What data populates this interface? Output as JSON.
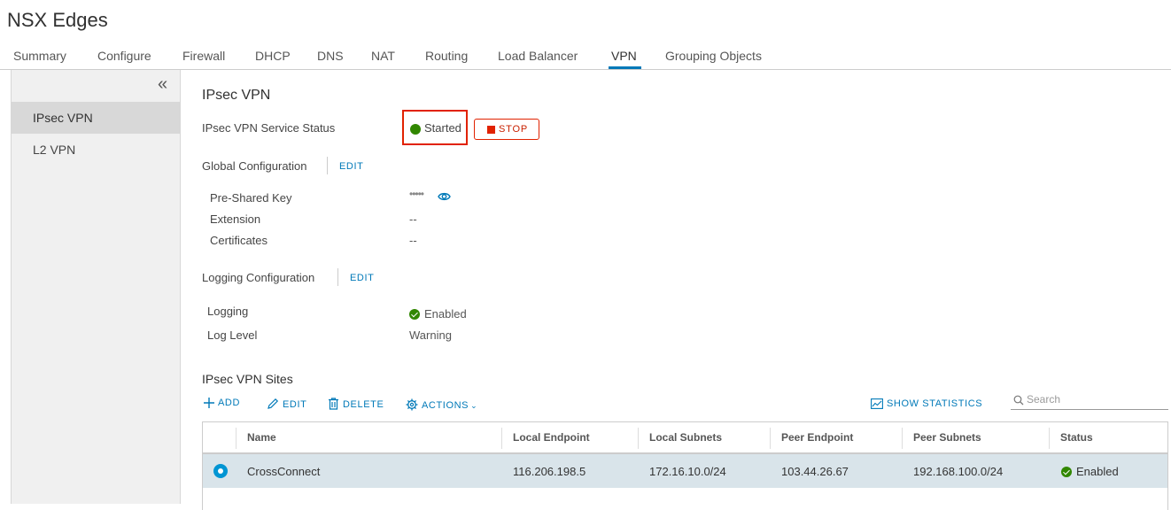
{
  "page": {
    "title": "NSX Edges"
  },
  "tabs": [
    {
      "label": "Summary"
    },
    {
      "label": "Configure"
    },
    {
      "label": "Firewall"
    },
    {
      "label": "DHCP"
    },
    {
      "label": "DNS"
    },
    {
      "label": "NAT"
    },
    {
      "label": "Routing"
    },
    {
      "label": "Load Balancer"
    },
    {
      "label": "VPN"
    },
    {
      "label": "Grouping Objects"
    }
  ],
  "active_tab": "VPN",
  "sidebar": {
    "collapse_icon": "double-chevron-left-icon",
    "items": [
      {
        "label": "IPsec VPN",
        "active": true
      },
      {
        "label": "L2 VPN",
        "active": false
      }
    ]
  },
  "ipsec": {
    "title": "IPsec VPN",
    "service_status_label": "IPsec VPN Service Status",
    "service_status_value": "Started",
    "stop_label": "STOP",
    "global_config_label": "Global Configuration",
    "global_edit": "EDIT",
    "psk_label": "Pre-Shared Key",
    "psk_value": "•••••",
    "extension_label": "Extension",
    "extension_value": "--",
    "certificates_label": "Certificates",
    "certificates_value": "--",
    "logging_config_label": "Logging Configuration",
    "logging_edit": "EDIT",
    "logging_label": "Logging",
    "logging_value": "Enabled",
    "log_level_label": "Log Level",
    "log_level_value": "Warning"
  },
  "sites": {
    "title": "IPsec VPN Sites",
    "toolbar": {
      "add": "ADD",
      "edit": "EDIT",
      "delete": "DELETE",
      "actions": "ACTIONS",
      "show_statistics": "SHOW STATISTICS"
    },
    "search_placeholder": "Search",
    "columns": [
      "Name",
      "Local Endpoint",
      "Local Subnets",
      "Peer Endpoint",
      "Peer Subnets",
      "Status"
    ],
    "rows": [
      {
        "name": "CrossConnect",
        "local_endpoint": "116.206.198.5",
        "local_subnets": "172.16.10.0/24",
        "peer_endpoint": "103.44.26.67",
        "peer_subnets": "192.168.100.0/24",
        "status": "Enabled",
        "selected": true
      }
    ]
  },
  "colors": {
    "accent": "#0079b8",
    "success": "#318700",
    "danger": "#e12200"
  }
}
